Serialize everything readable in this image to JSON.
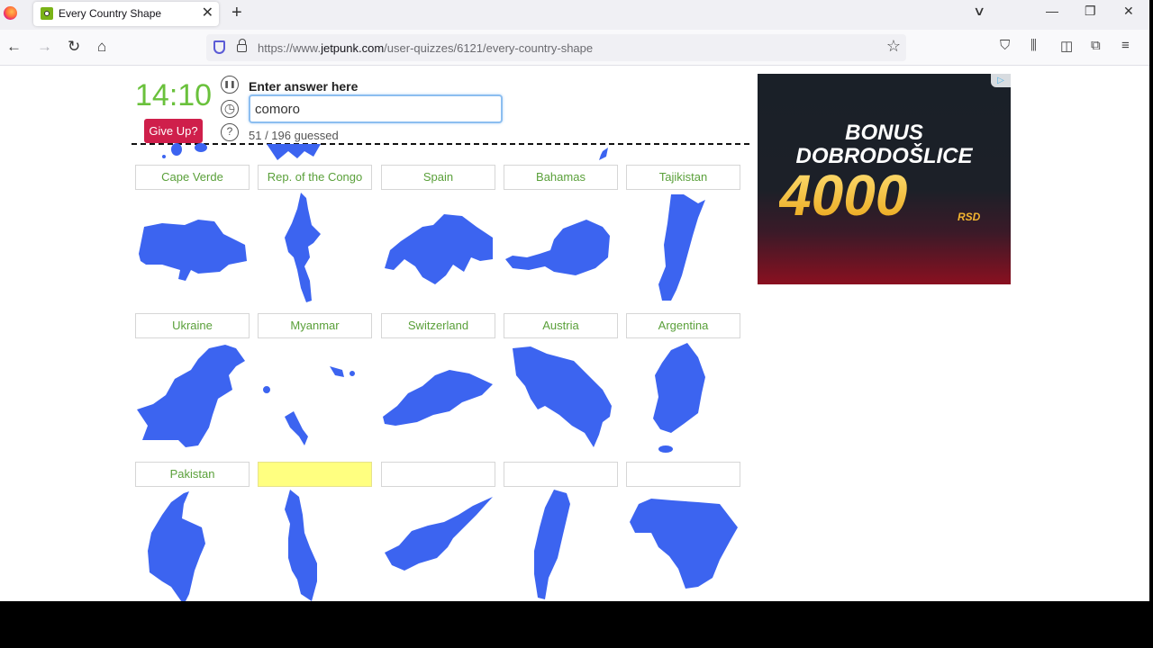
{
  "browser": {
    "tab_title": "Every Country Shape",
    "url_prefix": "https://www.",
    "url_domain": "jetpunk.com",
    "url_path": "/user-quizzes/6121/every-country-shape",
    "icons": {
      "back": "←",
      "forward": "→",
      "reload": "↻",
      "home": "⌂",
      "star": "☆",
      "pocket": "⛉",
      "library": "⫼",
      "sidebar": "◫",
      "extensions": "⧉",
      "menu": "≡",
      "tab_close": "✕",
      "new_tab": "+",
      "tab_list": "∨",
      "minimize": "—",
      "restore": "❐",
      "close": "✕"
    }
  },
  "quiz": {
    "timer": "14:10",
    "give_up_label": "Give Up?",
    "answer_label": "Enter answer here",
    "answer_value": "comoro",
    "guessed_text": "51 / 196 guessed",
    "pause_icon": "❚❚",
    "clock_icon": "◷",
    "help_icon": "?"
  },
  "rows": [
    {
      "labels": [
        "Cape Verde",
        "Rep. of the Congo",
        "Spain",
        "Bahamas",
        "Tajikistan"
      ]
    },
    {
      "labels": [
        "Ukraine",
        "Myanmar",
        "Switzerland",
        "Austria",
        "Argentina"
      ]
    },
    {
      "labels": [
        "Pakistan",
        "",
        "",
        "",
        ""
      ]
    },
    {
      "labels": []
    }
  ],
  "active_cell": {
    "row": 2,
    "col": 1
  },
  "shape_color": "#3c64f0",
  "ad": {
    "line1": "BONUS",
    "line2": "DOBRODOŠLICE",
    "amount": "4000",
    "currency": "RSD",
    "choice_icon": "▷"
  }
}
